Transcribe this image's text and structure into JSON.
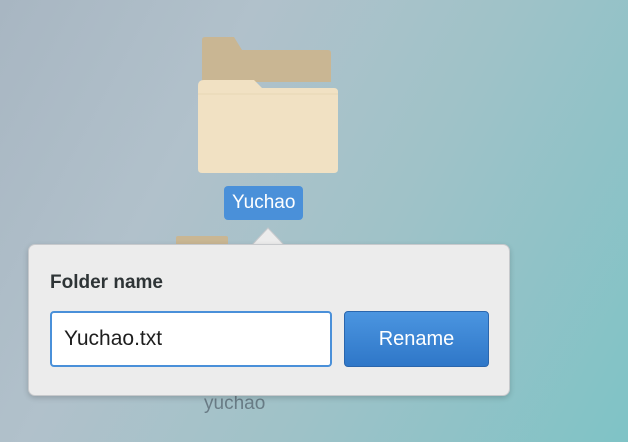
{
  "desktop": {
    "folder": {
      "label": "Yuchao",
      "icon": "folder-icon"
    },
    "second_item": {
      "label": "yuchao",
      "icon": "folder-icon"
    }
  },
  "rename_popover": {
    "title": "Folder name",
    "input_value": "Yuchao.txt",
    "button_label": "Rename"
  },
  "colors": {
    "accent": "#4a90d9",
    "button": "#3a86d4",
    "popover_bg": "#ececec",
    "folder_body": "#f1e1c3",
    "folder_back": "#c9b693"
  }
}
